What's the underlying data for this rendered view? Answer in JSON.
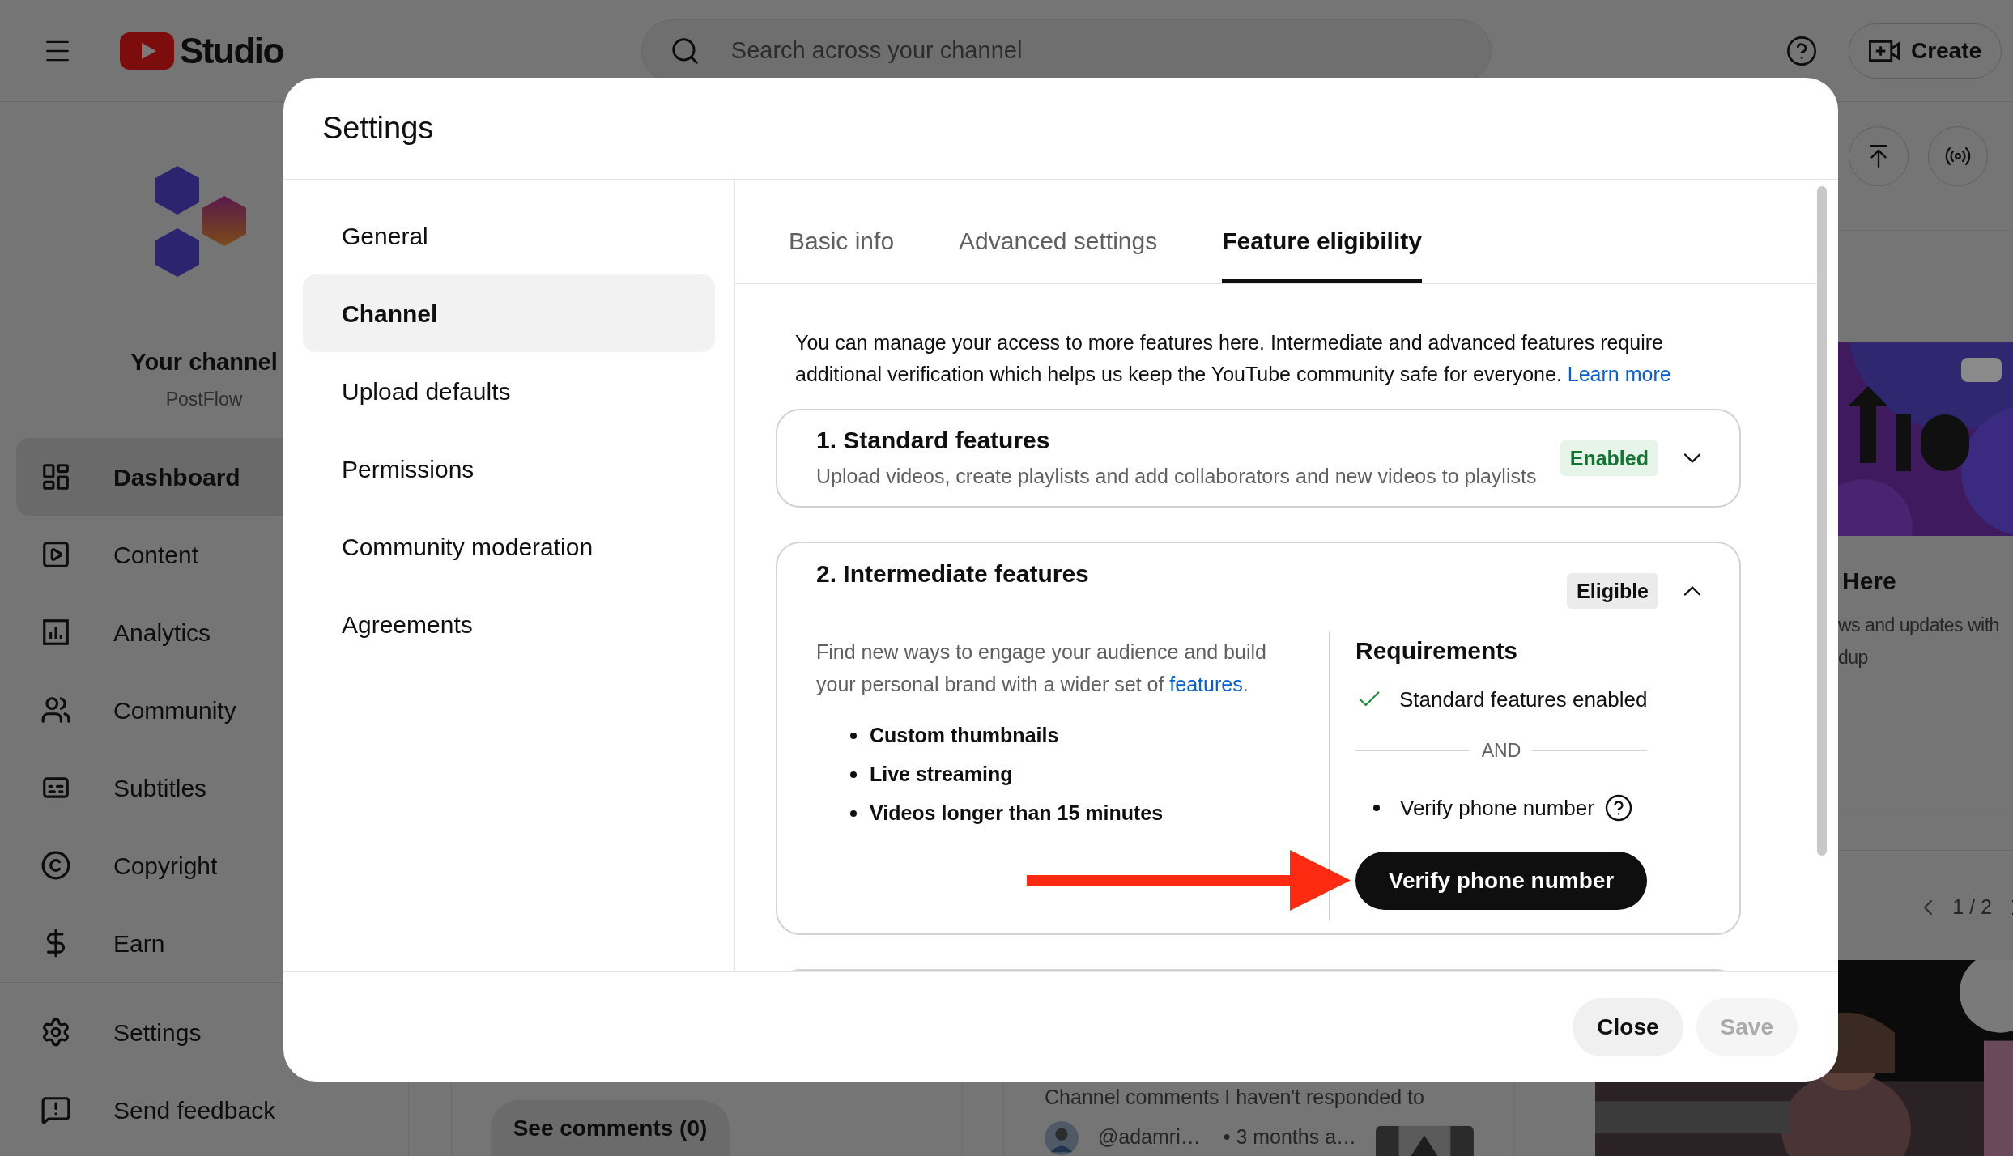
{
  "topbar": {
    "logo_text": "Studio",
    "search": {
      "placeholder": "Search across your channel"
    },
    "create_label": "Create"
  },
  "sidebar": {
    "channel_title": "Your channel",
    "channel_name": "PostFlow",
    "items": [
      {
        "label": "Dashboard",
        "selected": true
      },
      {
        "label": "Content",
        "selected": false
      },
      {
        "label": "Analytics",
        "selected": false
      },
      {
        "label": "Community",
        "selected": false
      },
      {
        "label": "Subtitles",
        "selected": false
      },
      {
        "label": "Copyright",
        "selected": false
      },
      {
        "label": "Earn",
        "selected": false
      }
    ],
    "footer_items": [
      {
        "label": "Settings",
        "selected": false
      },
      {
        "label": "Send feedback",
        "selected": false
      }
    ]
  },
  "dashboard": {
    "comments_card": {
      "button": "See comments (0)"
    },
    "unanswered_card": {
      "heading": "Channel comments I haven't responded to",
      "comment": {
        "author": "@adamri…",
        "time": "• 3 months a…"
      }
    },
    "news_card": {
      "title": "Here",
      "lines": [
        "ws and updates with",
        "dup"
      ],
      "pager": "1 / 2"
    }
  },
  "dialog": {
    "title": "Settings",
    "nav": [
      {
        "label": "General",
        "selected": false
      },
      {
        "label": "Channel",
        "selected": true
      },
      {
        "label": "Upload defaults",
        "selected": false
      },
      {
        "label": "Permissions",
        "selected": false
      },
      {
        "label": "Community moderation",
        "selected": false
      },
      {
        "label": "Agreements",
        "selected": false
      }
    ],
    "tabs": [
      {
        "label": "Basic info",
        "selected": false
      },
      {
        "label": "Advanced settings",
        "selected": false
      },
      {
        "label": "Feature eligibility",
        "selected": true
      }
    ],
    "intro": "You can manage your access to more features here. Intermediate and advanced features require additional verification which helps us keep the YouTube community safe for everyone.",
    "intro_link": "Learn more",
    "features": [
      {
        "title": "1. Standard features",
        "description": "Upload videos, create playlists and add collaborators and new videos to playlists",
        "status": {
          "label": "Enabled",
          "kind": "enabled"
        },
        "expanded": false
      },
      {
        "title": "2. Intermediate features",
        "status": {
          "label": "Eligible",
          "kind": "eligible"
        },
        "expanded": true,
        "description": "Find new ways to engage your audience and build your personal brand with a wider set of",
        "description_link": "features",
        "description_end": ".",
        "perks": [
          "Custom thumbnails",
          "Live streaming",
          "Videos longer than 15 minutes"
        ],
        "requirements": {
          "title": "Requirements",
          "items": [
            {
              "label": "Standard features enabled",
              "kind": "met"
            }
          ],
          "separator": "AND",
          "pending": [
            {
              "label": "Verify phone number",
              "kind": "todo"
            }
          ],
          "action": "Verify phone number"
        }
      }
    ],
    "buttons": [
      {
        "label": "Close",
        "disabled": false
      },
      {
        "label": "Save",
        "disabled": true
      }
    ]
  }
}
